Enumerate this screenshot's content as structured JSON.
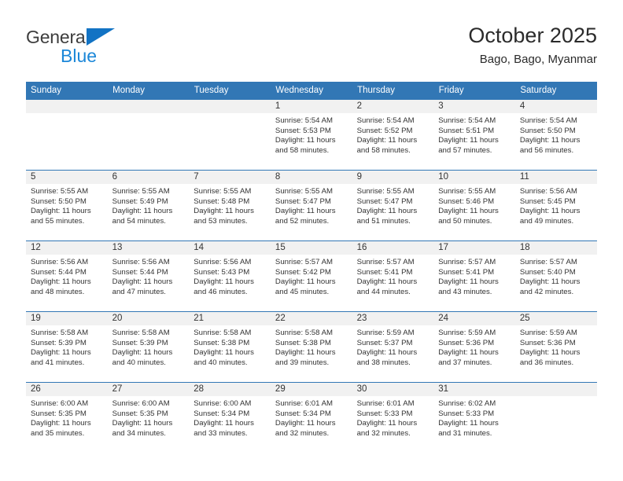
{
  "brand": {
    "name_part1": "General",
    "name_part2": "Blue",
    "triangle_color": "#1273c4",
    "blue_color": "#1b87d8"
  },
  "header": {
    "title": "October 2025",
    "subtitle": "Bago, Bago, Myanmar"
  },
  "theme": {
    "header_bg": "#3277b5",
    "header_text": "#ffffff",
    "daynum_bg": "#f1f1f1",
    "cell_bg": "#ffffff",
    "text": "#333333"
  },
  "weekdays": [
    "Sunday",
    "Monday",
    "Tuesday",
    "Wednesday",
    "Thursday",
    "Friday",
    "Saturday"
  ],
  "weeks": [
    [
      {
        "day": "",
        "blank": true
      },
      {
        "day": "",
        "blank": true
      },
      {
        "day": "",
        "blank": true
      },
      {
        "day": "1",
        "sunrise": "Sunrise: 5:54 AM",
        "sunset": "Sunset: 5:53 PM",
        "daylight1": "Daylight: 11 hours",
        "daylight2": "and 58 minutes."
      },
      {
        "day": "2",
        "sunrise": "Sunrise: 5:54 AM",
        "sunset": "Sunset: 5:52 PM",
        "daylight1": "Daylight: 11 hours",
        "daylight2": "and 58 minutes."
      },
      {
        "day": "3",
        "sunrise": "Sunrise: 5:54 AM",
        "sunset": "Sunset: 5:51 PM",
        "daylight1": "Daylight: 11 hours",
        "daylight2": "and 57 minutes."
      },
      {
        "day": "4",
        "sunrise": "Sunrise: 5:54 AM",
        "sunset": "Sunset: 5:50 PM",
        "daylight1": "Daylight: 11 hours",
        "daylight2": "and 56 minutes."
      }
    ],
    [
      {
        "day": "5",
        "sunrise": "Sunrise: 5:55 AM",
        "sunset": "Sunset: 5:50 PM",
        "daylight1": "Daylight: 11 hours",
        "daylight2": "and 55 minutes."
      },
      {
        "day": "6",
        "sunrise": "Sunrise: 5:55 AM",
        "sunset": "Sunset: 5:49 PM",
        "daylight1": "Daylight: 11 hours",
        "daylight2": "and 54 minutes."
      },
      {
        "day": "7",
        "sunrise": "Sunrise: 5:55 AM",
        "sunset": "Sunset: 5:48 PM",
        "daylight1": "Daylight: 11 hours",
        "daylight2": "and 53 minutes."
      },
      {
        "day": "8",
        "sunrise": "Sunrise: 5:55 AM",
        "sunset": "Sunset: 5:47 PM",
        "daylight1": "Daylight: 11 hours",
        "daylight2": "and 52 minutes."
      },
      {
        "day": "9",
        "sunrise": "Sunrise: 5:55 AM",
        "sunset": "Sunset: 5:47 PM",
        "daylight1": "Daylight: 11 hours",
        "daylight2": "and 51 minutes."
      },
      {
        "day": "10",
        "sunrise": "Sunrise: 5:55 AM",
        "sunset": "Sunset: 5:46 PM",
        "daylight1": "Daylight: 11 hours",
        "daylight2": "and 50 minutes."
      },
      {
        "day": "11",
        "sunrise": "Sunrise: 5:56 AM",
        "sunset": "Sunset: 5:45 PM",
        "daylight1": "Daylight: 11 hours",
        "daylight2": "and 49 minutes."
      }
    ],
    [
      {
        "day": "12",
        "sunrise": "Sunrise: 5:56 AM",
        "sunset": "Sunset: 5:44 PM",
        "daylight1": "Daylight: 11 hours",
        "daylight2": "and 48 minutes."
      },
      {
        "day": "13",
        "sunrise": "Sunrise: 5:56 AM",
        "sunset": "Sunset: 5:44 PM",
        "daylight1": "Daylight: 11 hours",
        "daylight2": "and 47 minutes."
      },
      {
        "day": "14",
        "sunrise": "Sunrise: 5:56 AM",
        "sunset": "Sunset: 5:43 PM",
        "daylight1": "Daylight: 11 hours",
        "daylight2": "and 46 minutes."
      },
      {
        "day": "15",
        "sunrise": "Sunrise: 5:57 AM",
        "sunset": "Sunset: 5:42 PM",
        "daylight1": "Daylight: 11 hours",
        "daylight2": "and 45 minutes."
      },
      {
        "day": "16",
        "sunrise": "Sunrise: 5:57 AM",
        "sunset": "Sunset: 5:41 PM",
        "daylight1": "Daylight: 11 hours",
        "daylight2": "and 44 minutes."
      },
      {
        "day": "17",
        "sunrise": "Sunrise: 5:57 AM",
        "sunset": "Sunset: 5:41 PM",
        "daylight1": "Daylight: 11 hours",
        "daylight2": "and 43 minutes."
      },
      {
        "day": "18",
        "sunrise": "Sunrise: 5:57 AM",
        "sunset": "Sunset: 5:40 PM",
        "daylight1": "Daylight: 11 hours",
        "daylight2": "and 42 minutes."
      }
    ],
    [
      {
        "day": "19",
        "sunrise": "Sunrise: 5:58 AM",
        "sunset": "Sunset: 5:39 PM",
        "daylight1": "Daylight: 11 hours",
        "daylight2": "and 41 minutes."
      },
      {
        "day": "20",
        "sunrise": "Sunrise: 5:58 AM",
        "sunset": "Sunset: 5:39 PM",
        "daylight1": "Daylight: 11 hours",
        "daylight2": "and 40 minutes."
      },
      {
        "day": "21",
        "sunrise": "Sunrise: 5:58 AM",
        "sunset": "Sunset: 5:38 PM",
        "daylight1": "Daylight: 11 hours",
        "daylight2": "and 40 minutes."
      },
      {
        "day": "22",
        "sunrise": "Sunrise: 5:58 AM",
        "sunset": "Sunset: 5:38 PM",
        "daylight1": "Daylight: 11 hours",
        "daylight2": "and 39 minutes."
      },
      {
        "day": "23",
        "sunrise": "Sunrise: 5:59 AM",
        "sunset": "Sunset: 5:37 PM",
        "daylight1": "Daylight: 11 hours",
        "daylight2": "and 38 minutes."
      },
      {
        "day": "24",
        "sunrise": "Sunrise: 5:59 AM",
        "sunset": "Sunset: 5:36 PM",
        "daylight1": "Daylight: 11 hours",
        "daylight2": "and 37 minutes."
      },
      {
        "day": "25",
        "sunrise": "Sunrise: 5:59 AM",
        "sunset": "Sunset: 5:36 PM",
        "daylight1": "Daylight: 11 hours",
        "daylight2": "and 36 minutes."
      }
    ],
    [
      {
        "day": "26",
        "sunrise": "Sunrise: 6:00 AM",
        "sunset": "Sunset: 5:35 PM",
        "daylight1": "Daylight: 11 hours",
        "daylight2": "and 35 minutes."
      },
      {
        "day": "27",
        "sunrise": "Sunrise: 6:00 AM",
        "sunset": "Sunset: 5:35 PM",
        "daylight1": "Daylight: 11 hours",
        "daylight2": "and 34 minutes."
      },
      {
        "day": "28",
        "sunrise": "Sunrise: 6:00 AM",
        "sunset": "Sunset: 5:34 PM",
        "daylight1": "Daylight: 11 hours",
        "daylight2": "and 33 minutes."
      },
      {
        "day": "29",
        "sunrise": "Sunrise: 6:01 AM",
        "sunset": "Sunset: 5:34 PM",
        "daylight1": "Daylight: 11 hours",
        "daylight2": "and 32 minutes."
      },
      {
        "day": "30",
        "sunrise": "Sunrise: 6:01 AM",
        "sunset": "Sunset: 5:33 PM",
        "daylight1": "Daylight: 11 hours",
        "daylight2": "and 32 minutes."
      },
      {
        "day": "31",
        "sunrise": "Sunrise: 6:02 AM",
        "sunset": "Sunset: 5:33 PM",
        "daylight1": "Daylight: 11 hours",
        "daylight2": "and 31 minutes."
      },
      {
        "day": "",
        "blank": true
      }
    ]
  ]
}
